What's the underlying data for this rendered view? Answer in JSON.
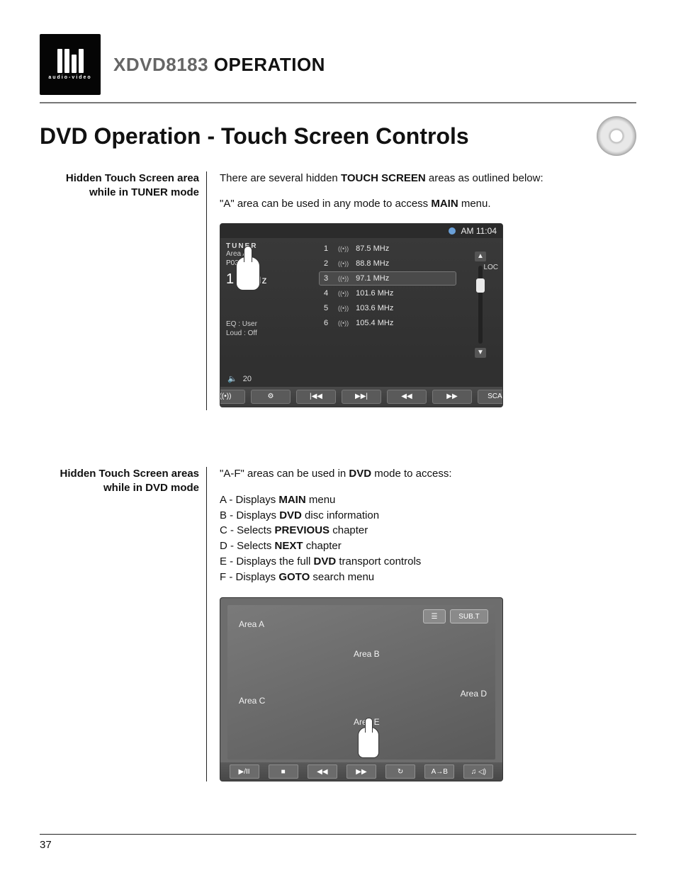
{
  "brand": {
    "logo_sub": "audio-video",
    "model": "XDVD8183",
    "operation": "OPERATION"
  },
  "page_title": "DVD Operation - Touch Screen Controls",
  "page_number": "37",
  "section1": {
    "side_label_l1": "Hidden Touch Screen area",
    "side_label_l2": "while in TUNER mode",
    "intro_a": "There are several hidden ",
    "intro_b": "TOUCH SCREEN",
    "intro_c": " areas as outlined below:",
    "line2_a": "\"A\" area can be used in any mode to access ",
    "line2_b": "MAIN",
    "line2_c": " menu."
  },
  "tuner": {
    "clock": "AM 11:04",
    "title": "TUNER",
    "area_label": "Area A",
    "preset": "P03  ST",
    "freq_unit": "MHz",
    "freq_bignum": "1",
    "eq_label": "EQ   : User",
    "loud_label": "Loud : Off",
    "loc": "LOC",
    "vol": "20",
    "presets": [
      {
        "n": "1",
        "f": "87.5 MHz"
      },
      {
        "n": "2",
        "f": "88.8 MHz"
      },
      {
        "n": "3",
        "f": "97.1 MHz"
      },
      {
        "n": "4",
        "f": "101.6 MHz"
      },
      {
        "n": "5",
        "f": "103.6 MHz"
      },
      {
        "n": "6",
        "f": "105.4 MHz"
      }
    ],
    "btns": {
      "local": "((•))",
      "settings": "⚙",
      "prev": "|◀◀",
      "next": "▶▶|",
      "rew": "◀◀",
      "ff": "▶▶",
      "scan": "SCAN"
    }
  },
  "section2": {
    "side_label_l1": "Hidden Touch Screen areas",
    "side_label_l2": "while in DVD mode",
    "intro_a": "\"A-F\" areas can be used in ",
    "intro_b": "DVD",
    "intro_c": " mode to access:",
    "items": [
      {
        "pre": "A - Displays ",
        "bold": "MAIN",
        "post": " menu"
      },
      {
        "pre": "B - Displays ",
        "bold": "DVD",
        "post": " disc information"
      },
      {
        "pre": "C - Selects ",
        "bold": "PREVIOUS",
        "post": " chapter"
      },
      {
        "pre": "D - Selects ",
        "bold": "NEXT",
        "post": " chapter"
      },
      {
        "pre": "E - Displays the full ",
        "bold": "DVD",
        "post": " transport controls"
      },
      {
        "pre": "F - Displays ",
        "bold": "GOTO",
        "post": " search menu"
      }
    ]
  },
  "dvd": {
    "labels": {
      "A": "Area A",
      "B": "Area B",
      "C": "Area C",
      "D": "Area D",
      "E": "Area E"
    },
    "subt": "SUB.T",
    "menu_icon": "☰",
    "bottom": {
      "play": "▶/II",
      "stop": "■",
      "rew": "◀◀",
      "ff": "▶▶",
      "repeat": "↻",
      "ab": "A→B",
      "sound": "♫ ◁)"
    }
  }
}
